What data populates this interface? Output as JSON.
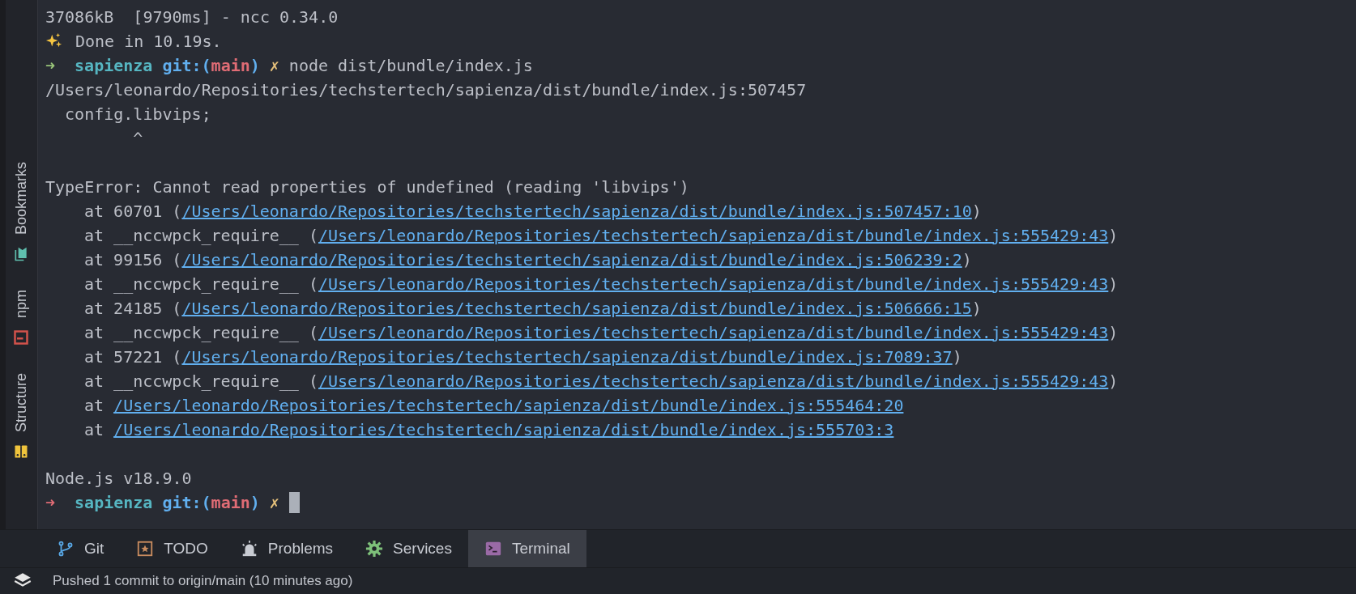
{
  "sidebar": {
    "items": [
      {
        "label": "Bookmarks",
        "kind": "bookmarks"
      },
      {
        "label": "npm",
        "kind": "npm"
      },
      {
        "label": "Structure",
        "kind": "structure"
      }
    ]
  },
  "terminal": {
    "lines": [
      {
        "kind": "plain",
        "text": "37086kB  [9790ms] - ncc 0.34.0"
      },
      {
        "kind": "done",
        "text": "Done in 10.19s."
      },
      {
        "kind": "prompt",
        "last_failed": false,
        "arrow": "➜",
        "dir": "sapienza",
        "git_open": "git:(",
        "branch": "main",
        "git_close": ")",
        "dirty_mark": "✗",
        "command": "node dist/bundle/index.js",
        "cursor": false
      },
      {
        "kind": "plain",
        "text": "/Users/leonardo/Repositories/techstertech/sapienza/dist/bundle/index.js:507457"
      },
      {
        "kind": "plain",
        "text": "  config.libvips;"
      },
      {
        "kind": "plain",
        "text": "         ^"
      },
      {
        "kind": "blank"
      },
      {
        "kind": "plain",
        "text": "TypeError: Cannot read properties of undefined (reading 'libvips')"
      },
      {
        "kind": "trace",
        "prefix": "at 60701 (",
        "link": "/Users/leonardo/Repositories/techstertech/sapienza/dist/bundle/index.js:507457:10",
        "suffix": ")"
      },
      {
        "kind": "trace",
        "prefix": "at __nccwpck_require__ (",
        "link": "/Users/leonardo/Repositories/techstertech/sapienza/dist/bundle/index.js:555429:43",
        "suffix": ")"
      },
      {
        "kind": "trace",
        "prefix": "at 99156 (",
        "link": "/Users/leonardo/Repositories/techstertech/sapienza/dist/bundle/index.js:506239:2",
        "suffix": ")"
      },
      {
        "kind": "trace",
        "prefix": "at __nccwpck_require__ (",
        "link": "/Users/leonardo/Repositories/techstertech/sapienza/dist/bundle/index.js:555429:43",
        "suffix": ")"
      },
      {
        "kind": "trace",
        "prefix": "at 24185 (",
        "link": "/Users/leonardo/Repositories/techstertech/sapienza/dist/bundle/index.js:506666:15",
        "suffix": ")"
      },
      {
        "kind": "trace",
        "prefix": "at __nccwpck_require__ (",
        "link": "/Users/leonardo/Repositories/techstertech/sapienza/dist/bundle/index.js:555429:43",
        "suffix": ")"
      },
      {
        "kind": "trace",
        "prefix": "at 57221 (",
        "link": "/Users/leonardo/Repositories/techstertech/sapienza/dist/bundle/index.js:7089:37",
        "suffix": ")"
      },
      {
        "kind": "trace",
        "prefix": "at __nccwpck_require__ (",
        "link": "/Users/leonardo/Repositories/techstertech/sapienza/dist/bundle/index.js:555429:43",
        "suffix": ")"
      },
      {
        "kind": "trace",
        "prefix": "at",
        "link": "/Users/leonardo/Repositories/techstertech/sapienza/dist/bundle/index.js:555464:20"
      },
      {
        "kind": "trace",
        "prefix": "at",
        "link": "/Users/leonardo/Repositories/techstertech/sapienza/dist/bundle/index.js:555703:3"
      },
      {
        "kind": "blank"
      },
      {
        "kind": "plain",
        "text": "Node.js v18.9.0"
      },
      {
        "kind": "prompt",
        "last_failed": true,
        "arrow": "➜",
        "dir": "sapienza",
        "git_open": "git:(",
        "branch": "main",
        "git_close": ")",
        "dirty_mark": "✗",
        "cursor": true
      }
    ]
  },
  "tool_tabs": [
    {
      "label": "Git",
      "kind": "git",
      "selected": false
    },
    {
      "label": "TODO",
      "kind": "todo",
      "selected": false
    },
    {
      "label": "Problems",
      "kind": "problems",
      "selected": false
    },
    {
      "label": "Services",
      "kind": "services",
      "selected": false
    },
    {
      "label": "Terminal",
      "kind": "terminal",
      "selected": true
    }
  ],
  "status_bar": {
    "text": "Pushed 1 commit to origin/main (10 minutes ago)"
  }
}
